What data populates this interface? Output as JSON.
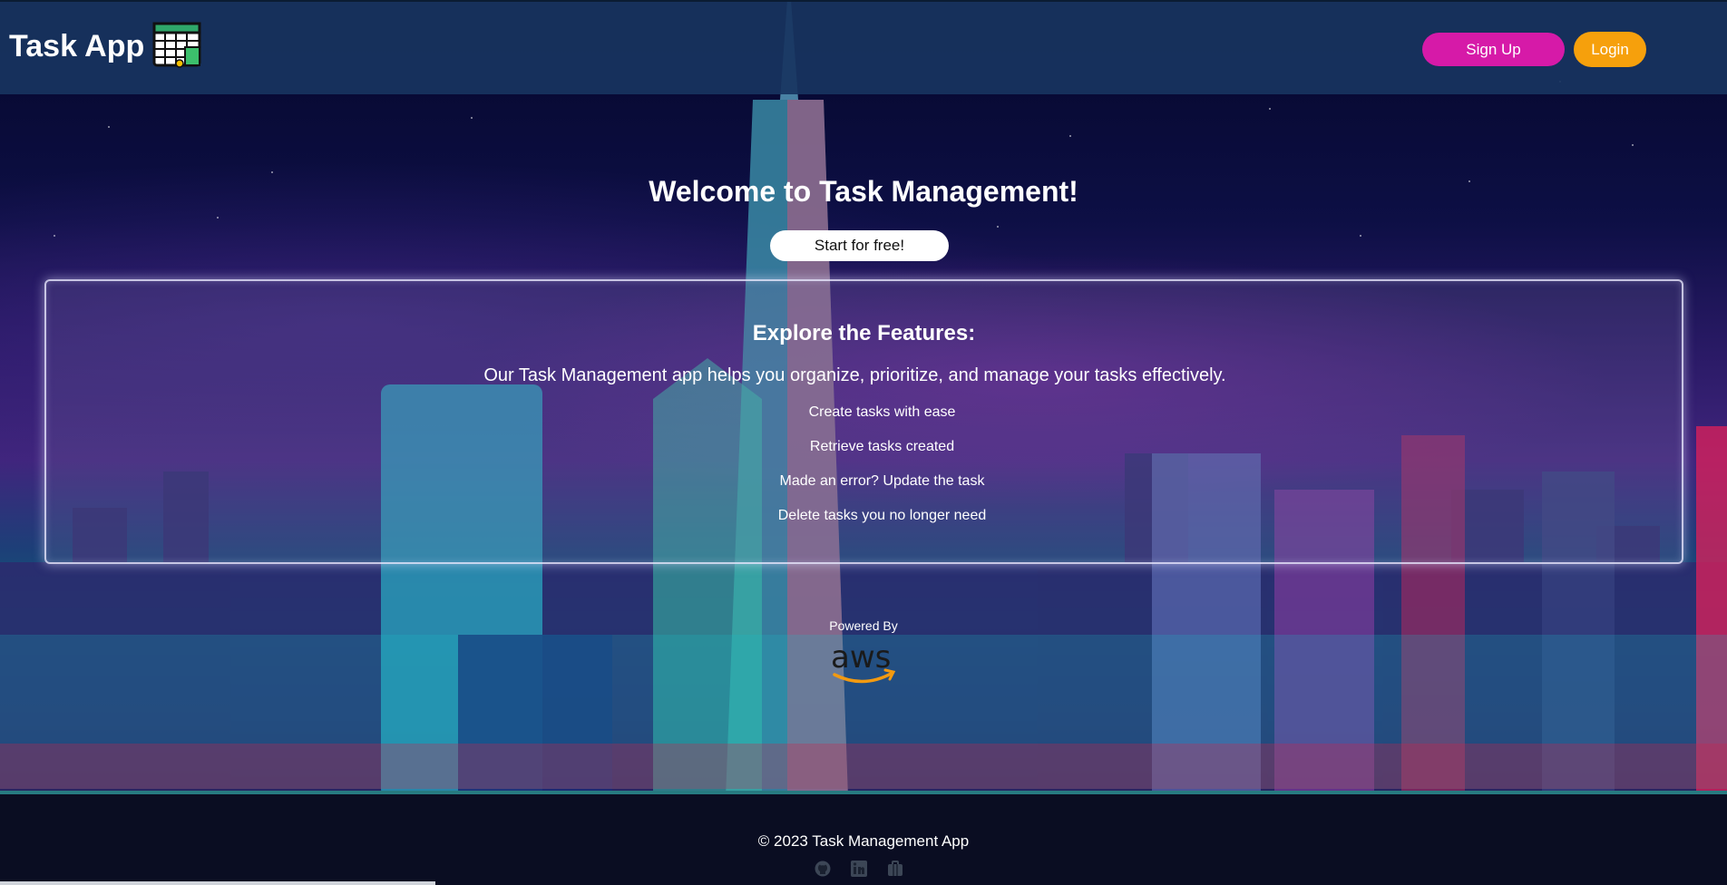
{
  "header": {
    "brand": "Task App",
    "signup_label": "Sign Up",
    "login_label": "Login"
  },
  "hero": {
    "title": "Welcome to Task Management!",
    "cta_label": "Start for free!"
  },
  "features": {
    "title": "Explore the Features:",
    "description": "Our Task Management app helps you organize, prioritize, and manage your tasks effectively.",
    "items": [
      "Create tasks with ease",
      "Retrieve tasks created",
      "Made an error? Update the task",
      "Delete tasks you no longer need"
    ]
  },
  "powered": {
    "label": "Powered By",
    "logo_text": "aws"
  },
  "footer": {
    "copyright": "© 2023 Task Management App",
    "social_icons": [
      "github-icon",
      "linkedin-icon",
      "briefcase-icon"
    ]
  },
  "colors": {
    "header_bg": "#183460",
    "signup": "#d61aa8",
    "login": "#f6a00c",
    "aws_smile": "#f39a10"
  }
}
